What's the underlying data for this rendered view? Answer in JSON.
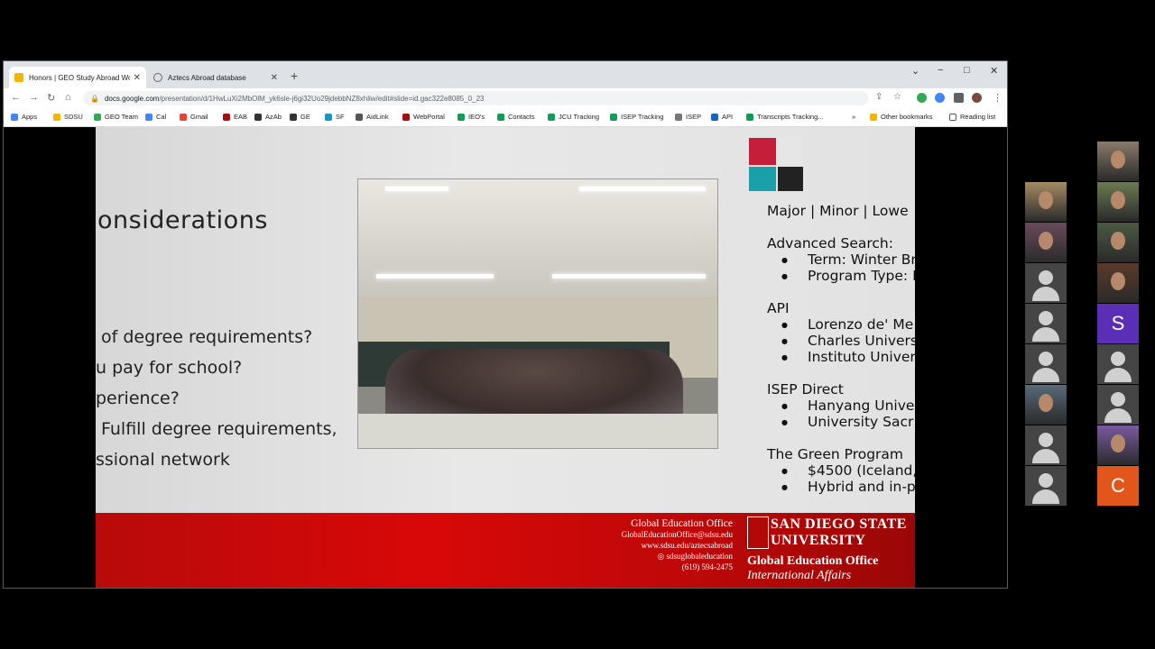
{
  "browser": {
    "tabs": [
      {
        "title": "Honors | GEO Study Abroad Wor",
        "active": true,
        "favicon_color": "#f4b400"
      },
      {
        "title": "Aztecs Abroad database",
        "active": false,
        "favicon_color": "#777777"
      }
    ],
    "new_tab": "+",
    "window_controls": {
      "dropdown": "⌄",
      "minimize": "−",
      "maximize": "□",
      "close": "✕"
    },
    "url": {
      "host": "docs.google.com",
      "path": "/presentation/d/1HwLuXi2MbOlM_yk6sle-j6gi32Uo29jdebbNZ8xhliw/edit#slide=id.gac322e8085_0_23"
    },
    "bookmarks": [
      {
        "label": "Apps",
        "color": "#4285f4"
      },
      {
        "label": "SDSU",
        "color": "#f4b400"
      },
      {
        "label": "GEO Team",
        "color": "#34a853"
      },
      {
        "label": "Cal",
        "color": "#4285f4"
      },
      {
        "label": "Gmail",
        "color": "#ea4335"
      },
      {
        "label": "EAB",
        "color": "#a50e0e"
      },
      {
        "label": "AzAb",
        "color": "#333333"
      },
      {
        "label": "GE",
        "color": "#333333"
      },
      {
        "label": "SF",
        "color": "#1798c1"
      },
      {
        "label": "AidLink",
        "color": "#555555"
      },
      {
        "label": "WebPortal",
        "color": "#a50e0e"
      },
      {
        "label": "IEO's",
        "color": "#0f9d58"
      },
      {
        "label": "Contacts",
        "color": "#0f9d58"
      },
      {
        "label": "JCU Tracking",
        "color": "#0f9d58"
      },
      {
        "label": "ISEP Tracking",
        "color": "#0f9d58"
      },
      {
        "label": "ISEP",
        "color": "#777777"
      },
      {
        "label": "API",
        "color": "#1565c0"
      },
      {
        "label": "Transcripts Tracking...",
        "color": "#0f9d58"
      }
    ],
    "overflow": "»",
    "other_bookmarks": "Other bookmarks",
    "reading_list": "Reading list"
  },
  "slide": {
    "title": "onsiderations",
    "bullets": [
      "of degree requirements?",
      "u pay for school?",
      "perience?",
      "Fulfill degree requirements,",
      "ssional network"
    ],
    "right_column": [
      {
        "text": "Major | Minor | Lowe",
        "type": "head"
      },
      {
        "text": "",
        "type": "gap"
      },
      {
        "text": "Advanced Search:",
        "type": "head"
      },
      {
        "text": "Term: Winter Br",
        "type": "sub"
      },
      {
        "text": "Program Type: F",
        "type": "sub"
      },
      {
        "text": "",
        "type": "gap"
      },
      {
        "text": "API",
        "type": "head"
      },
      {
        "text": "Lorenzo de' Me",
        "type": "sub"
      },
      {
        "text": "Charles Univers",
        "type": "sub"
      },
      {
        "text": "Instituto Univers",
        "type": "sub"
      },
      {
        "text": "",
        "type": "gap"
      },
      {
        "text": "ISEP Direct",
        "type": "head"
      },
      {
        "text": "Hanyang Unive",
        "type": "sub"
      },
      {
        "text": "University Sacr",
        "type": "sub"
      },
      {
        "text": "",
        "type": "gap"
      },
      {
        "text": "The Green Program",
        "type": "head"
      },
      {
        "text": "$4500 (Iceland,",
        "type": "sub"
      },
      {
        "text": "Hybrid and in-p",
        "type": "sub"
      }
    ],
    "footer": {
      "office": "Global Education Office",
      "email": "GlobalEducationOffice@sdsu.edu",
      "web": "www.sdsu.edu/aztecsabroad",
      "social": "sdsuglobaleducation",
      "phone": "(619) 594-2475",
      "brand_line1": "San Diego State",
      "brand_line2": "University",
      "brand_office": "Global Education Office",
      "brand_sub": "International Affairs"
    },
    "colors": {
      "footer_red": "#c80808",
      "text": "#222222"
    }
  },
  "participants": [
    {
      "kind": "video",
      "color": "#8a7a6a"
    },
    {
      "kind": "video",
      "color": "#a58a62"
    },
    {
      "kind": "video",
      "color": "#6b7a52"
    },
    {
      "kind": "video",
      "color": "#6a4b5c"
    },
    {
      "kind": "video",
      "color": "#4c5a44"
    },
    {
      "kind": "avatar"
    },
    {
      "kind": "video",
      "color": "#5a3a2a"
    },
    {
      "kind": "avatar"
    },
    {
      "kind": "letter",
      "letter": "S",
      "color": "#5b2fb5"
    },
    {
      "kind": "avatar"
    },
    {
      "kind": "avatar"
    },
    {
      "kind": "video",
      "color": "#5a6a7a"
    },
    {
      "kind": "avatar"
    },
    {
      "kind": "avatar"
    },
    {
      "kind": "video",
      "color": "#7a5aa0"
    },
    {
      "kind": "avatar"
    },
    {
      "kind": "letter",
      "letter": "C",
      "color": "#e2561c"
    }
  ]
}
